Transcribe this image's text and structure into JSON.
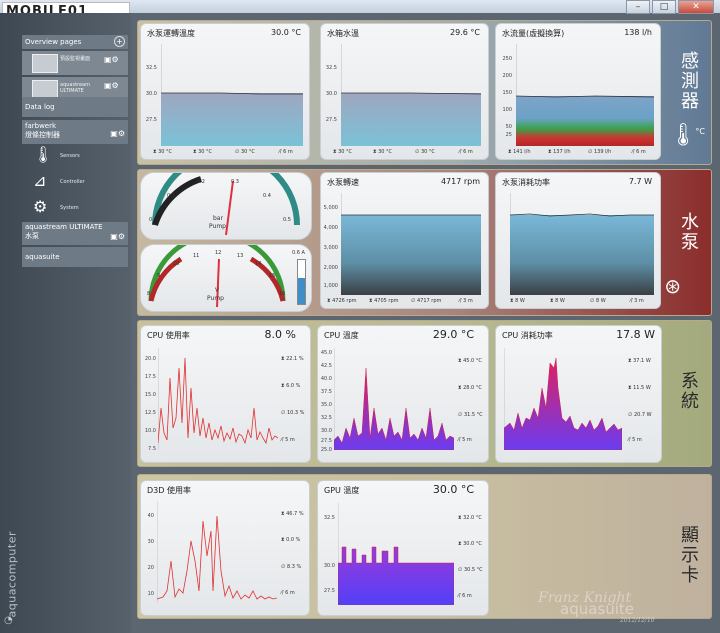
{
  "window": {
    "logo": "MOBILE01",
    "minimize": "–",
    "maximize": "□",
    "close": "✕"
  },
  "sidebar": {
    "overview_label": "Overview pages",
    "add_icon": "+",
    "overview_items": [
      {
        "label": "預設監視畫面"
      },
      {
        "label": "aquastream ULTIMATE"
      }
    ],
    "datalog": "Data log",
    "farbwerk_line1": "farbwerk",
    "farbwerk_line2": "燈條控制器",
    "sub_items": [
      {
        "label": "Sensors"
      },
      {
        "label": "Controller"
      },
      {
        "label": "System"
      }
    ],
    "aquastream_line1": "aquastream ULTIMATE",
    "aquastream_line2": "水泵",
    "aquasuite": "aquasuite",
    "vertical_brand": "aquacomputer"
  },
  "sections": {
    "sensors": "感測器",
    "pump": "水泵",
    "system": "系統",
    "gpu": "顯示卡"
  },
  "units": {
    "celsius": "°C"
  },
  "panels": {
    "p1": {
      "title": "水泵運轉溫度",
      "value": "30.0 °C",
      "yticks": [
        "32.5",
        "30.0",
        "27.5"
      ],
      "f1": "30 °C",
      "f2": "30 °C",
      "f3": "30 °C",
      "f4": "6 m"
    },
    "p2": {
      "title": "水箱水溫",
      "value": "29.6 °C",
      "yticks": [
        "32.5",
        "30.0",
        "27.5"
      ],
      "f1": "30 °C",
      "f2": "30 °C",
      "f3": "30 °C",
      "f4": "6 m"
    },
    "p3": {
      "title": "水流量(虛擬換算)",
      "value": "138 l/h",
      "yticks": [
        "250",
        "200",
        "150",
        "100",
        "50",
        "25"
      ],
      "f1": "141 l/h",
      "f2": "137 l/h",
      "f3": "139 l/h",
      "f4": "6 m"
    },
    "g1": {
      "ticks": [
        "0",
        "0.1",
        "0.2",
        "0.3",
        "0.4",
        "0.5"
      ],
      "unit": "bar",
      "label": "Pump"
    },
    "g2": {
      "ticks": [
        "8",
        "9",
        "10",
        "11",
        "12",
        "13",
        "14",
        "15",
        "16"
      ],
      "unit": "V",
      "label": "Pump",
      "bar_label": "0.6 A"
    },
    "p4": {
      "title": "水泵轉速",
      "value": "4717 rpm",
      "yticks": [
        "5,000",
        "4,000",
        "3,000",
        "2,000",
        "1,000"
      ],
      "f1": "4726 rpm",
      "f2": "4705 rpm",
      "f3": "4717 rpm",
      "f4": "3 m"
    },
    "p5": {
      "title": "水泵消耗功率",
      "value": "7.7 W",
      "f1": "8 W",
      "f2": "8 W",
      "f3": "8 W",
      "f4": "3 m"
    },
    "p6": {
      "title": "CPU 使用率",
      "value": "8.0 %",
      "yticks": [
        "20.0",
        "17.5",
        "15.0",
        "12.5",
        "10.0",
        "7.5"
      ],
      "s1": "22.1 %",
      "s2": "6.0 %",
      "s3": "10.3 %",
      "s4": "5 m"
    },
    "p7": {
      "title": "CPU 溫度",
      "value": "29.0 °C",
      "yticks": [
        "45.0",
        "42.5",
        "40.0",
        "37.5",
        "35.0",
        "32.5",
        "30.0",
        "27.5",
        "25.0"
      ],
      "s1": "45.0 °C",
      "s2": "28.0 °C",
      "s3": "31.5 °C",
      "s4": "5 m"
    },
    "p8": {
      "title": "CPU 消耗功率",
      "value": "17.8 W",
      "s1": "37.1 W",
      "s2": "11.5 W",
      "s3": "20.7 W",
      "s4": "5 m"
    },
    "p9": {
      "title": "D3D 使用率",
      "value": "",
      "yticks": [
        "40",
        "30",
        "20",
        "10"
      ],
      "s1": "46.7 %",
      "s2": "0.0 %",
      "s3": "8.3 %",
      "s4": "6 m"
    },
    "p10": {
      "title": "GPU 溫度",
      "value": "30.0 °C",
      "yticks": [
        "32.5",
        "30.0",
        "27.5"
      ],
      "s1": "32.0 °C",
      "s2": "30.0 °C",
      "s3": "30.5 °C",
      "s4": "6 m"
    }
  },
  "watermark": {
    "line1": "Franz Knight",
    "line2": "aquasuite",
    "line3": "2012/12/10"
  },
  "colors": {
    "accent_red": "#e0303a",
    "tank_blue": "#6fb0cf",
    "cpu_purple": "#8a3cf0",
    "flow_red": "#d03030",
    "flow_green": "#3aa24c"
  }
}
